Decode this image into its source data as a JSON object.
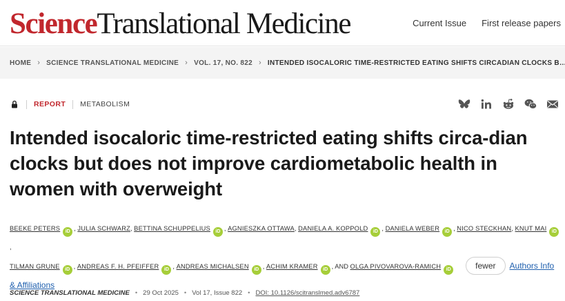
{
  "header": {
    "logo_science": "Science",
    "logo_rest": "Translational Medicine",
    "nav": [
      "Current Issue",
      "First release papers"
    ]
  },
  "breadcrumb": {
    "items": [
      "HOME",
      "SCIENCE TRANSLATIONAL MEDICINE",
      "VOL. 17, NO. 822"
    ],
    "current": "INTENDED ISOCALORIC TIME-RESTRICTED EATING SHIFTS CIRCADIAN CLOCKS BUT DOES NOT IMPROVE CARDIOMETABOLIC HEALTH IN WOMEN WITH OVERWEIGHT"
  },
  "article": {
    "access_icon": "lock-icon",
    "type": "REPORT",
    "category": "METABOLISM",
    "title": "Intended isocaloric time-restricted eating shifts circa-dian clocks but does not improve cardiometabolic health in women with overweight",
    "authors_line1": [
      {
        "name": "BEEKE PETERS",
        "orcid": true
      },
      {
        "name": "JULIA SCHWARZ",
        "orcid": false
      },
      {
        "name": "BETTINA SCHUPPELIUS",
        "orcid": true
      },
      {
        "name": "AGNIESZKA OTTAWA",
        "orcid": false
      },
      {
        "name": "DANIELA A. KOPPOLD",
        "orcid": true
      },
      {
        "name": "DANIELA WEBER",
        "orcid": true
      },
      {
        "name": "NICO STECKHAN",
        "orcid": false
      },
      {
        "name": "KNUT MAI",
        "orcid": true
      }
    ],
    "authors_line2": [
      {
        "name": "TILMAN GRUNE",
        "orcid": true
      },
      {
        "name": "ANDREAS F. H. PFEIFFER",
        "orcid": true
      },
      {
        "name": "ANDREAS MICHALSEN",
        "orcid": true
      },
      {
        "name": "ACHIM KRAMER",
        "orcid": true
      }
    ],
    "and_text": ", AND",
    "last_author": {
      "name": "OLGA PIVOVAROVA-RAMICH",
      "orcid": true
    },
    "orcid_text": "iD",
    "fewer_label": "fewer",
    "affiliations_label": "Authors Info & Affiliations",
    "journal": "SCIENCE TRANSLATIONAL MEDICINE",
    "date": "29 Oct 2025",
    "volume": "Vol 17, Issue 822",
    "doi": "DOI: 10.1126/scitranslmed.adv6787"
  },
  "share_icons": [
    "bluesky-icon",
    "linkedin-icon",
    "reddit-icon",
    "wechat-icon",
    "email-icon"
  ],
  "colors": {
    "brand": "#c1272d",
    "orcid": "#a6ce39",
    "link": "#1f5fae"
  }
}
